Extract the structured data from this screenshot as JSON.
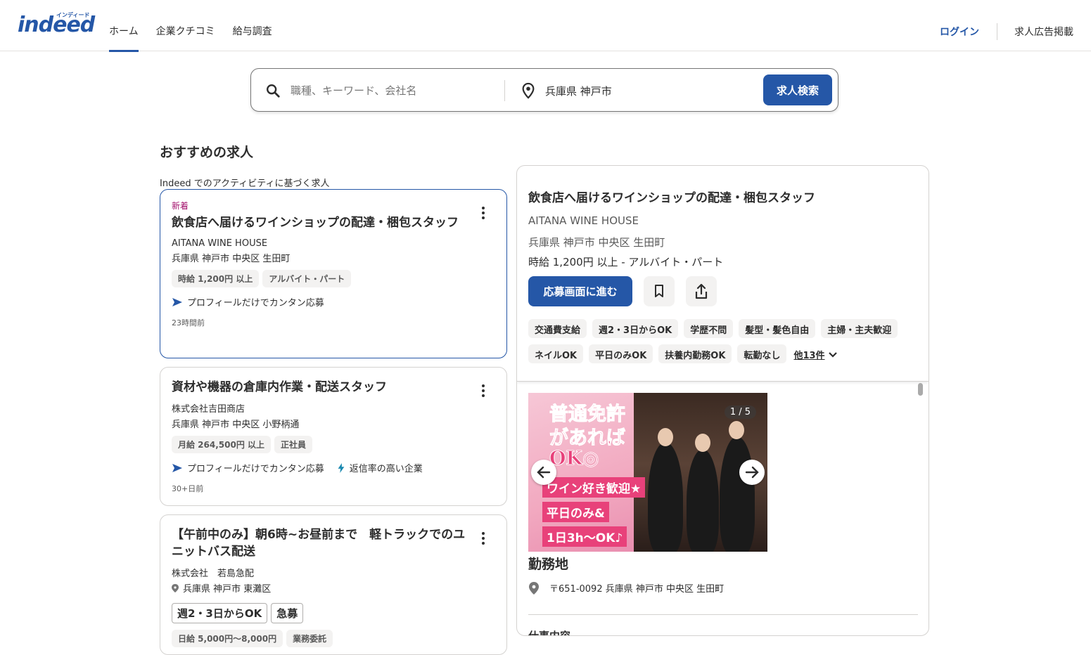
{
  "header": {
    "logo": "indeed",
    "logo_kana": "インディード",
    "nav": [
      "ホーム",
      "企業クチコミ",
      "給与調査"
    ],
    "login": "ログイン",
    "employer": "求人広告掲載"
  },
  "search": {
    "what_placeholder": "職種、キーワード、会社名",
    "where_value": "兵庫県 神戸市",
    "button": "求人検索"
  },
  "section": {
    "title": "おすすめの求人",
    "subtitle": "Indeed でのアクティビティに基づく求人"
  },
  "jobs": [
    {
      "new": "新着",
      "title": "飲食店へ届けるワインショップの配達・梱包スタッフ",
      "company": "AITANA WINE HOUSE",
      "location": "兵庫県 神戸市 中央区 生田町",
      "tags": [
        "時給 1,200円 以上",
        "アルバイト・パート"
      ],
      "feature1": "プロフィールだけでカンタン応募",
      "posted": "23時間前"
    },
    {
      "title": "資材や機器の倉庫内作業・配送スタッフ",
      "company": "株式会社吉田商店",
      "location": "兵庫県 神戸市 中央区 小野柄通",
      "tags": [
        "月給 264,500円 以上",
        "正社員"
      ],
      "feature1": "プロフィールだけでカンタン応募",
      "feature2": "返信率の高い企業",
      "posted": "30+日前"
    },
    {
      "title": "【午前中のみ】朝6時~お昼前まで　軽トラックでのユニットバス配送",
      "company": "株式会社　若島急配",
      "location": "兵庫県 神戸市 東灘区",
      "tags": [
        "週2・3日からOK",
        "急募"
      ],
      "tags2": [
        "日給 5,000円～8,000円",
        "業務委託"
      ]
    }
  ],
  "detail": {
    "title": "飲食店へ届けるワインショップの配達・梱包スタッフ",
    "company": "AITANA WINE HOUSE",
    "location": "兵庫県 神戸市 中央区 生田町",
    "salary": "時給 1,200円 以上  - アルバイト・パート",
    "apply": "応募画面に進む",
    "tags": [
      "交通費支給",
      "週2・3日からOK",
      "学歴不問",
      "髪型・髪色自由",
      "主婦・主夫歓迎",
      "ネイルOK",
      "平日のみOK",
      "扶養内勤務OK",
      "転勤なし"
    ],
    "more": "他13件",
    "carousel": {
      "counter": "1 / 5",
      "lines": [
        "普通免許",
        "があれば",
        "OK◎",
        "ワイン好き歓迎★",
        "平日のみ&",
        "1日3h～OK♪"
      ]
    },
    "workplace_heading": "勤務地",
    "workplace_address": "〒651-0092 兵庫県 神戸市 中央区 生田町",
    "job_desc_heading": "仕事内容"
  }
}
